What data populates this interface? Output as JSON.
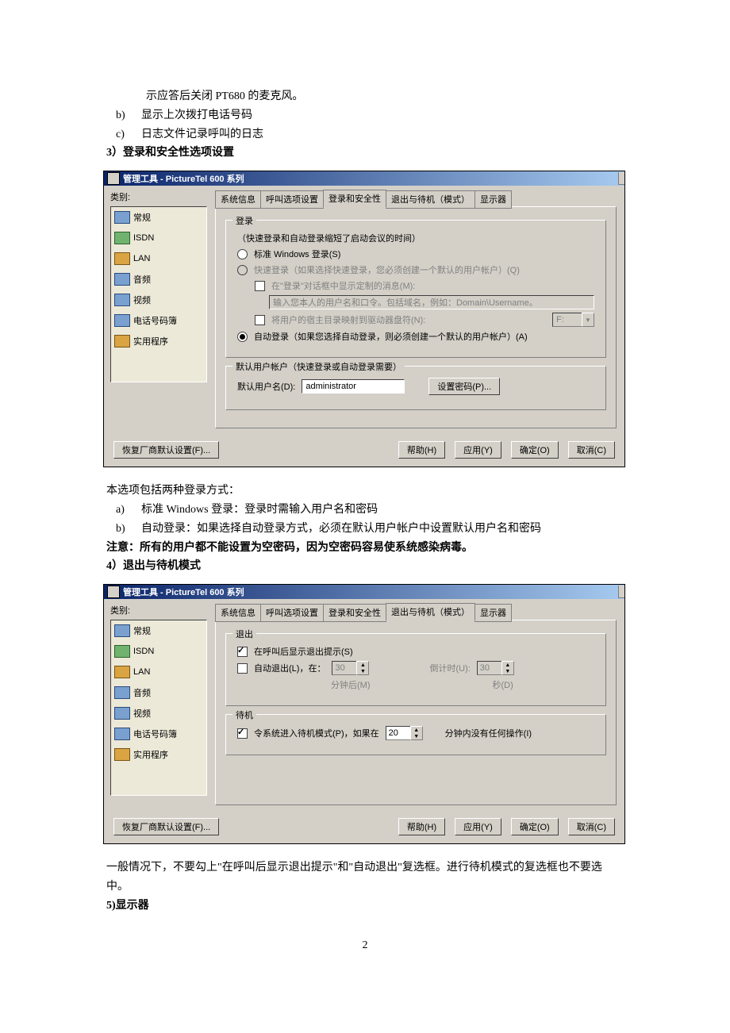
{
  "text": {
    "line1": "示应答后关闭 PT680 的麦克风。",
    "li_b_marker": "b)",
    "li_b": "显示上次拨打电话号码",
    "li_c_marker": "c)",
    "li_c": "日志文件记录呼叫的日志",
    "h3": "3）登录和安全性选项设置",
    "after1_1": "本选项包括两种登录方式：",
    "after1_a_m": "a)",
    "after1_a": "标准 Windows 登录：登录时需输入用户名和密码",
    "after1_b_m": "b)",
    "after1_b": "自动登录：如果选择自动登录方式，必须在默认用户帐户中设置默认用户名和密码",
    "warn": "注意：所有的用户都不能设置为空密码，因为空密码容易使系统感染病毒。",
    "h4": "4）退出与待机模式",
    "after2_1": "一般情况下，不要勾上\"在呼叫后显示退出提示\"和\"自动退出\"复选框。进行待机模式的复选框也不要选中。",
    "h5": "5)显示器",
    "pagenum": "2"
  },
  "dlg_common": {
    "title": "管理工具 - PictureTel 600 系列",
    "cat_label": "类别:",
    "categories": [
      "常规",
      "ISDN",
      "LAN",
      "音频",
      "视频",
      "电话号码簿",
      "实用程序"
    ],
    "tabs": [
      "系统信息",
      "呼叫选项设置",
      "登录和安全性",
      "退出与待机（模式）",
      "显示器"
    ],
    "restore": "恢复厂商默认设置(F)...",
    "help": "帮助(H)",
    "apply": "应用(Y)",
    "ok": "确定(O)",
    "cancel": "取消(C)"
  },
  "dlg1": {
    "group_login": "登录",
    "login_note": "（快速登录和自动登录缩短了启动会议的时间）",
    "r_windows": "标准 Windows 登录(S)",
    "r_fast": "快速登录（如果选择快速登录，您必须创建一个默认的用户帐户）(Q)",
    "cb_showdef": "在\"登录\"对话框中显示定制的消息(M):",
    "placeholder": "输入您本人的用户名和口令。包括域名，例如：Domain\\Username。",
    "cb_mapdrive": "将用户的宿主目录映射到驱动器盘符(N):",
    "drive_val": "F:",
    "r_auto": "自动登录（如果您选择自动登录，则必须创建一个默认的用户帐户）(A)",
    "group_user": "默认用户帐户（快速登录或自动登录需要）",
    "user_label": "默认用户名(D):",
    "user_value": "administrator",
    "btn_pw": "设置密码(P)..."
  },
  "dlg2": {
    "group_exit": "退出",
    "cb_showexit": "在呼叫后显示退出提示(S)",
    "cb_autoexit": "自动退出(L)，在：",
    "autoexit_val": "30",
    "autoexit_unit": "分钟后(M)",
    "cd_label": "倒计时(U):",
    "cd_val": "30",
    "cd_unit": "秒(D)",
    "group_standby": "待机",
    "cb_standby": "令系统进入待机模式(P)，如果在",
    "sb_val": "20",
    "sb_tail": "分钟内没有任何操作(I)"
  }
}
